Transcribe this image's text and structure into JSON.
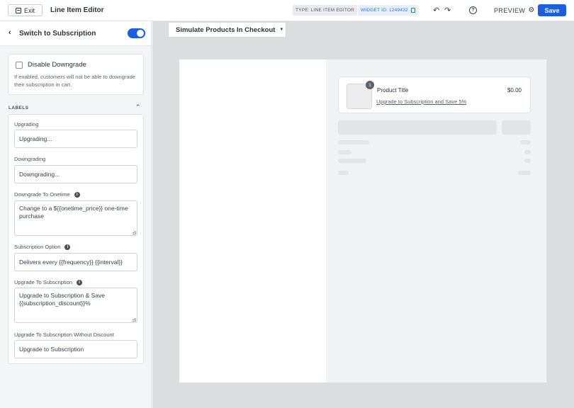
{
  "topbar": {
    "exit_label": "Exit",
    "title": "Line Item Editor",
    "type_badge": "TYPE: LINE ITEM EDITOR",
    "widget_id": "WIDGET ID: 1249432",
    "preview_label": "PREVIEW",
    "save_label": "Save",
    "accent_color": "#1a5fde"
  },
  "sidebar": {
    "title": "Switch to Subscription",
    "toggle_on": true,
    "disable_downgrade": {
      "label": "Disable Downgrade",
      "checked": false,
      "help": "If enabled, customers will not be able to downgrade their subscription in cart."
    },
    "labels_section": "LABELS",
    "fields": [
      {
        "label": "Upgrading",
        "value": "Upgrading...",
        "info": false
      },
      {
        "label": "Downgrading",
        "value": "Downgrading...",
        "info": false
      },
      {
        "label": "Downgrade To Onetime",
        "value": "Change to a ${{onetime_price}} one-time purchase",
        "info": true
      },
      {
        "label": "Subscription Option",
        "value": "Delivers every {{frequency}} {{interval}}",
        "info": true
      },
      {
        "label": "Upgrade To Subscription",
        "value": "Upgrade to Subscription & Save {{subscription_discount}}%",
        "info": true
      },
      {
        "label": "Upgrade To Subscription Without Discount",
        "value": "Upgrade to Subscription",
        "info": false
      }
    ]
  },
  "canvas": {
    "simulate_label": "Simulate Products In Checkout",
    "line_item": {
      "quantity": "1",
      "title": "Product Title",
      "price": "$0.00",
      "upgrade_link": "Upgrade to Subscription and Save 5%"
    }
  }
}
